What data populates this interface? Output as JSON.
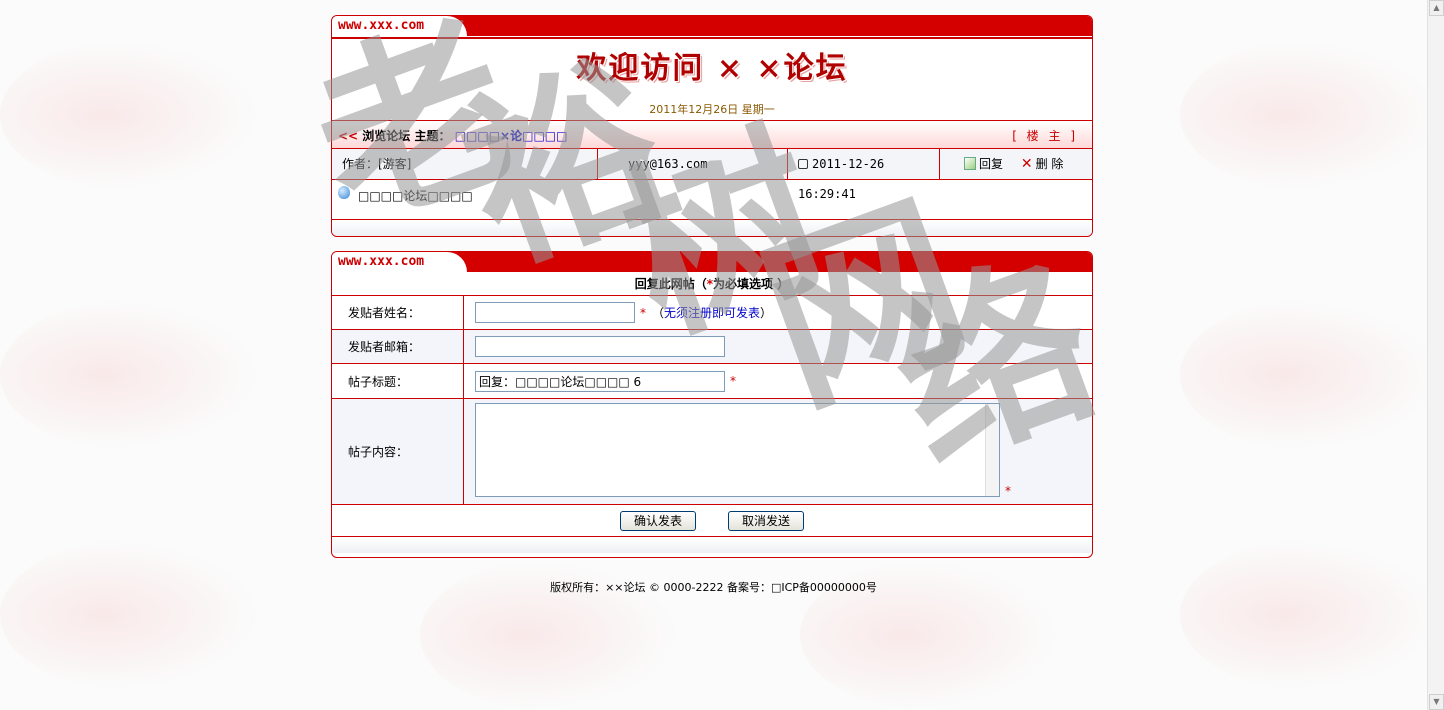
{
  "header": {
    "site_label": "www.xxx.com",
    "title": "欢迎访问 × ×论坛",
    "date": "2011年12月26日 星期一"
  },
  "topic": {
    "prefix": "<<",
    "label_prefix": "浏览论坛",
    "subject_label": "主题：",
    "subject": "□□□□×论□□□□",
    "floor": "[ 楼 主 ]"
  },
  "post": {
    "author": "作者：[游客]",
    "email": "yyy@163.com",
    "timestamp": "2011-12-26 16:29:41",
    "reply_label": "回复",
    "delete_label": "删 除",
    "content": "□□□□论坛□□□□"
  },
  "reply_form": {
    "site_label": "www.xxx.com",
    "heading_left": "回复此网帖（",
    "heading_star": "*",
    "heading_right": "为必填选项 ）",
    "name_label": "发贴者姓名：",
    "name_value": "",
    "name_hint_prefix": "（",
    "name_hint_link": "无须注册即可发表",
    "name_hint_suffix": "）",
    "email_label": "发贴者邮箱：",
    "email_value": "",
    "title_label": "帖子标题：",
    "title_value": "回复：□□□□论坛□□□□ 6",
    "content_label": "帖子内容：",
    "content_value": "",
    "required_mark": "*",
    "submit_label": "确认发表",
    "cancel_label": "取消发送"
  },
  "footer": {
    "copyright": "版权所有：××论坛 © 0000-2222 备案号：□ICP备00000000号"
  },
  "watermark": {
    "chars": [
      "老",
      "裕",
      "树",
      "网",
      "络"
    ]
  }
}
